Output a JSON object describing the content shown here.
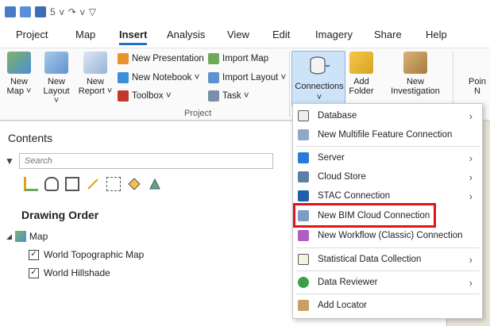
{
  "quick_access": {
    "undo_label": "5",
    "separator": "v",
    "customize": "▽"
  },
  "tabs": [
    {
      "label": "Project"
    },
    {
      "label": "Map"
    },
    {
      "label": "Insert"
    },
    {
      "label": "Analysis"
    },
    {
      "label": "View"
    },
    {
      "label": "Edit"
    },
    {
      "label": "Imagery"
    },
    {
      "label": "Share"
    },
    {
      "label": "Help"
    }
  ],
  "ribbon": {
    "new_map": "New\nMap ˅",
    "new_layout": "New\nLayout ˅",
    "new_report": "New\nReport ˅",
    "new_presentation": "New Presentation",
    "new_notebook": "New Notebook ˅",
    "toolbox": "Toolbox ˅",
    "import_map": "Import Map",
    "import_layout": "Import Layout ˅",
    "task": "Task ˅",
    "group_project": "Project",
    "connections": "Connections",
    "connections_arrow": "˅",
    "add_folder": "Add\nFolder",
    "new_investigation": "New\nInvestigation",
    "point_partial": "Poin\nN"
  },
  "contents": {
    "title": "Contents",
    "search_placeholder": "Search",
    "drawing_order": "Drawing Order",
    "map_label": "Map",
    "layers": [
      {
        "label": "World Topographic Map",
        "checked": true
      },
      {
        "label": "World Hillshade",
        "checked": true
      }
    ]
  },
  "menu": {
    "items": [
      {
        "label": "Database",
        "submenu": true
      },
      {
        "label": "New Multifile Feature Connection",
        "submenu": false
      },
      {
        "label": "Server",
        "submenu": true
      },
      {
        "label": "Cloud Store",
        "submenu": true
      },
      {
        "label": "STAC Connection",
        "submenu": true
      },
      {
        "label": "New BIM Cloud Connection",
        "submenu": false
      },
      {
        "label": "New Workflow (Classic) Connection",
        "submenu": false
      },
      {
        "label": "Statistical Data Collection",
        "submenu": true
      },
      {
        "label": "Data Reviewer",
        "submenu": true
      },
      {
        "label": "Add Locator",
        "submenu": false
      }
    ],
    "chevron": "›"
  },
  "colors": {
    "accent": "#1d6fd1",
    "highlight_box": "#e1141a",
    "connections_bg": "#cde3f7"
  }
}
